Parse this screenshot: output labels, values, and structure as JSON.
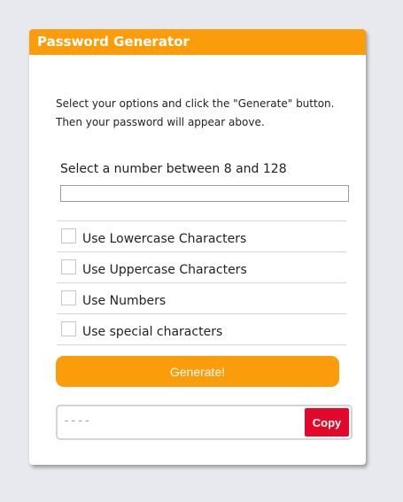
{
  "header": {
    "title": "Password Generator"
  },
  "intro": {
    "text": "Select your options and click the \"Generate\" button. Then your password will appear above."
  },
  "length": {
    "label": "Select a number between 8 and 128",
    "value": ""
  },
  "options": [
    {
      "label": "Use Lowercase Characters",
      "checked": false
    },
    {
      "label": "Use Uppercase Characters",
      "checked": false
    },
    {
      "label": "Use Numbers",
      "checked": false
    },
    {
      "label": "Use special characters",
      "checked": false
    }
  ],
  "generate": {
    "label": "Generate!"
  },
  "output": {
    "value": "----",
    "copy_label": "Copy"
  },
  "colors": {
    "accent": "#fb9d0a",
    "copy": "#e3082a",
    "background": "#e8e9ee"
  }
}
